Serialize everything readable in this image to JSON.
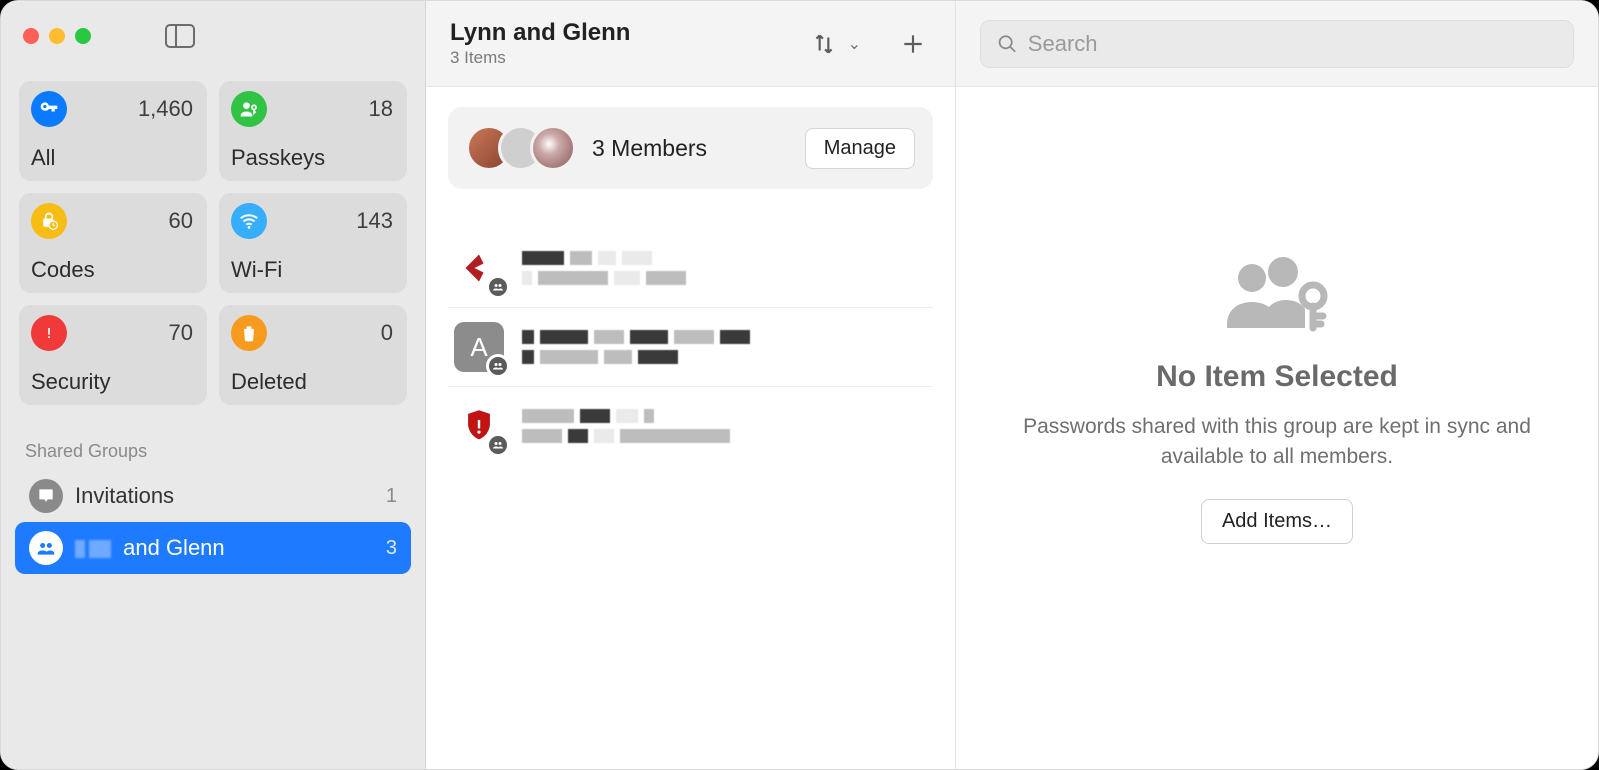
{
  "colors": {
    "accent": "#1e7bff",
    "all": "#0a7aff",
    "passkeys": "#30c345",
    "codes": "#f7bd14",
    "wifi": "#36aefb",
    "security": "#f03a3a",
    "deleted": "#f79b1f"
  },
  "sidebar": {
    "categories": [
      {
        "key": "all",
        "label": "All",
        "count": "1,460"
      },
      {
        "key": "passkeys",
        "label": "Passkeys",
        "count": "18"
      },
      {
        "key": "codes",
        "label": "Codes",
        "count": "60"
      },
      {
        "key": "wifi",
        "label": "Wi-Fi",
        "count": "143"
      },
      {
        "key": "security",
        "label": "Security",
        "count": "70"
      },
      {
        "key": "deleted",
        "label": "Deleted",
        "count": "0"
      }
    ],
    "shared_header": "Shared Groups",
    "invitations": {
      "label": "Invitations",
      "count": "1"
    },
    "group": {
      "label_suffix": "and Glenn",
      "count": "3"
    }
  },
  "middle": {
    "title": "Lynn and Glenn",
    "subtitle": "3 Items",
    "members_label": "3 Members",
    "manage_label": "Manage"
  },
  "search": {
    "placeholder": "Search"
  },
  "empty": {
    "title": "No Item Selected",
    "desc": "Passwords shared with this group are kept in sync and available to all members.",
    "button": "Add Items…"
  }
}
